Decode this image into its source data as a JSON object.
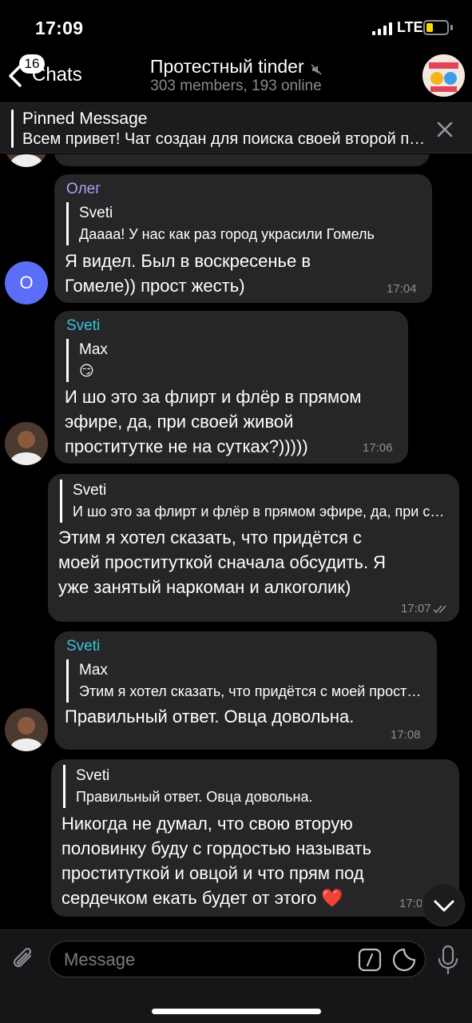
{
  "status_bar": {
    "time": "17:09",
    "network": "LTE"
  },
  "header": {
    "back_label": "Chats",
    "unread_badge": "16",
    "title": "Протестный tinder",
    "subtitle": "303 members, 193 online"
  },
  "pinned": {
    "title": "Pinned Message",
    "text": "Всем привет! Чат создан для поиска своей второй половинки"
  },
  "messages": [
    {
      "sender": "Олег",
      "sender_color": "#b59cf2",
      "avatar_letter": "O",
      "reply_name": "Sveti",
      "reply_text": "Даааа! У нас как раз город украсили Гомель",
      "lines": [
        "Я видел. Был в воскресенье в",
        "Гомеле)) прост жесть)"
      ],
      "time": "17:04"
    },
    {
      "sender": "Sveti",
      "sender_color": "#39c2d7",
      "reply_name": "Max",
      "reply_text": "😏",
      "lines": [
        "И шо это за флирт и флёр в прямом",
        "эфире, да, при своей живой",
        "проститутке не на сутках?)))))"
      ],
      "time": "17:06"
    },
    {
      "outgoing": true,
      "reply_name": "Sveti",
      "reply_text": "И шо это за флирт и флёр в прямом эфире, да, при своей",
      "lines": [
        "Этим я хотел сказать, что придётся с",
        "моей проституткой сначала обсудить. Я",
        "уже занятый наркоман и алкоголик)"
      ],
      "time": "17:07"
    },
    {
      "sender": "Sveti",
      "sender_color": "#39c2d7",
      "reply_name": "Max",
      "reply_text": "Этим я хотел сказать, что придётся с моей проституткой",
      "lines": [
        "Правильный ответ. Овца довольна."
      ],
      "time": "17:08"
    },
    {
      "outgoing": true,
      "reply_name": "Sveti",
      "reply_text": "Правильный ответ. Овца довольна.",
      "lines": [
        "Никогда не думал, что свою вторую",
        "половинку буду с гордостью называть",
        "проституткой и овцой и что прям под",
        "сердечком екать будет от этого ❤️"
      ],
      "time": "17:0"
    }
  ],
  "composer": {
    "placeholder": "Message"
  },
  "colors": {
    "background": "#000000",
    "bubble": "#262628",
    "accent_purple": "#b59cf2",
    "accent_cyan": "#39c2d7",
    "avatar_blue": "#5b6ef7",
    "battery": "#ffd60a"
  },
  "icons": [
    "chevron-left-icon",
    "mute-icon",
    "close-icon",
    "paperclip-icon",
    "slash-command-icon",
    "sticker-icon",
    "microphone-icon",
    "chevron-down-icon",
    "double-check-icon"
  ]
}
